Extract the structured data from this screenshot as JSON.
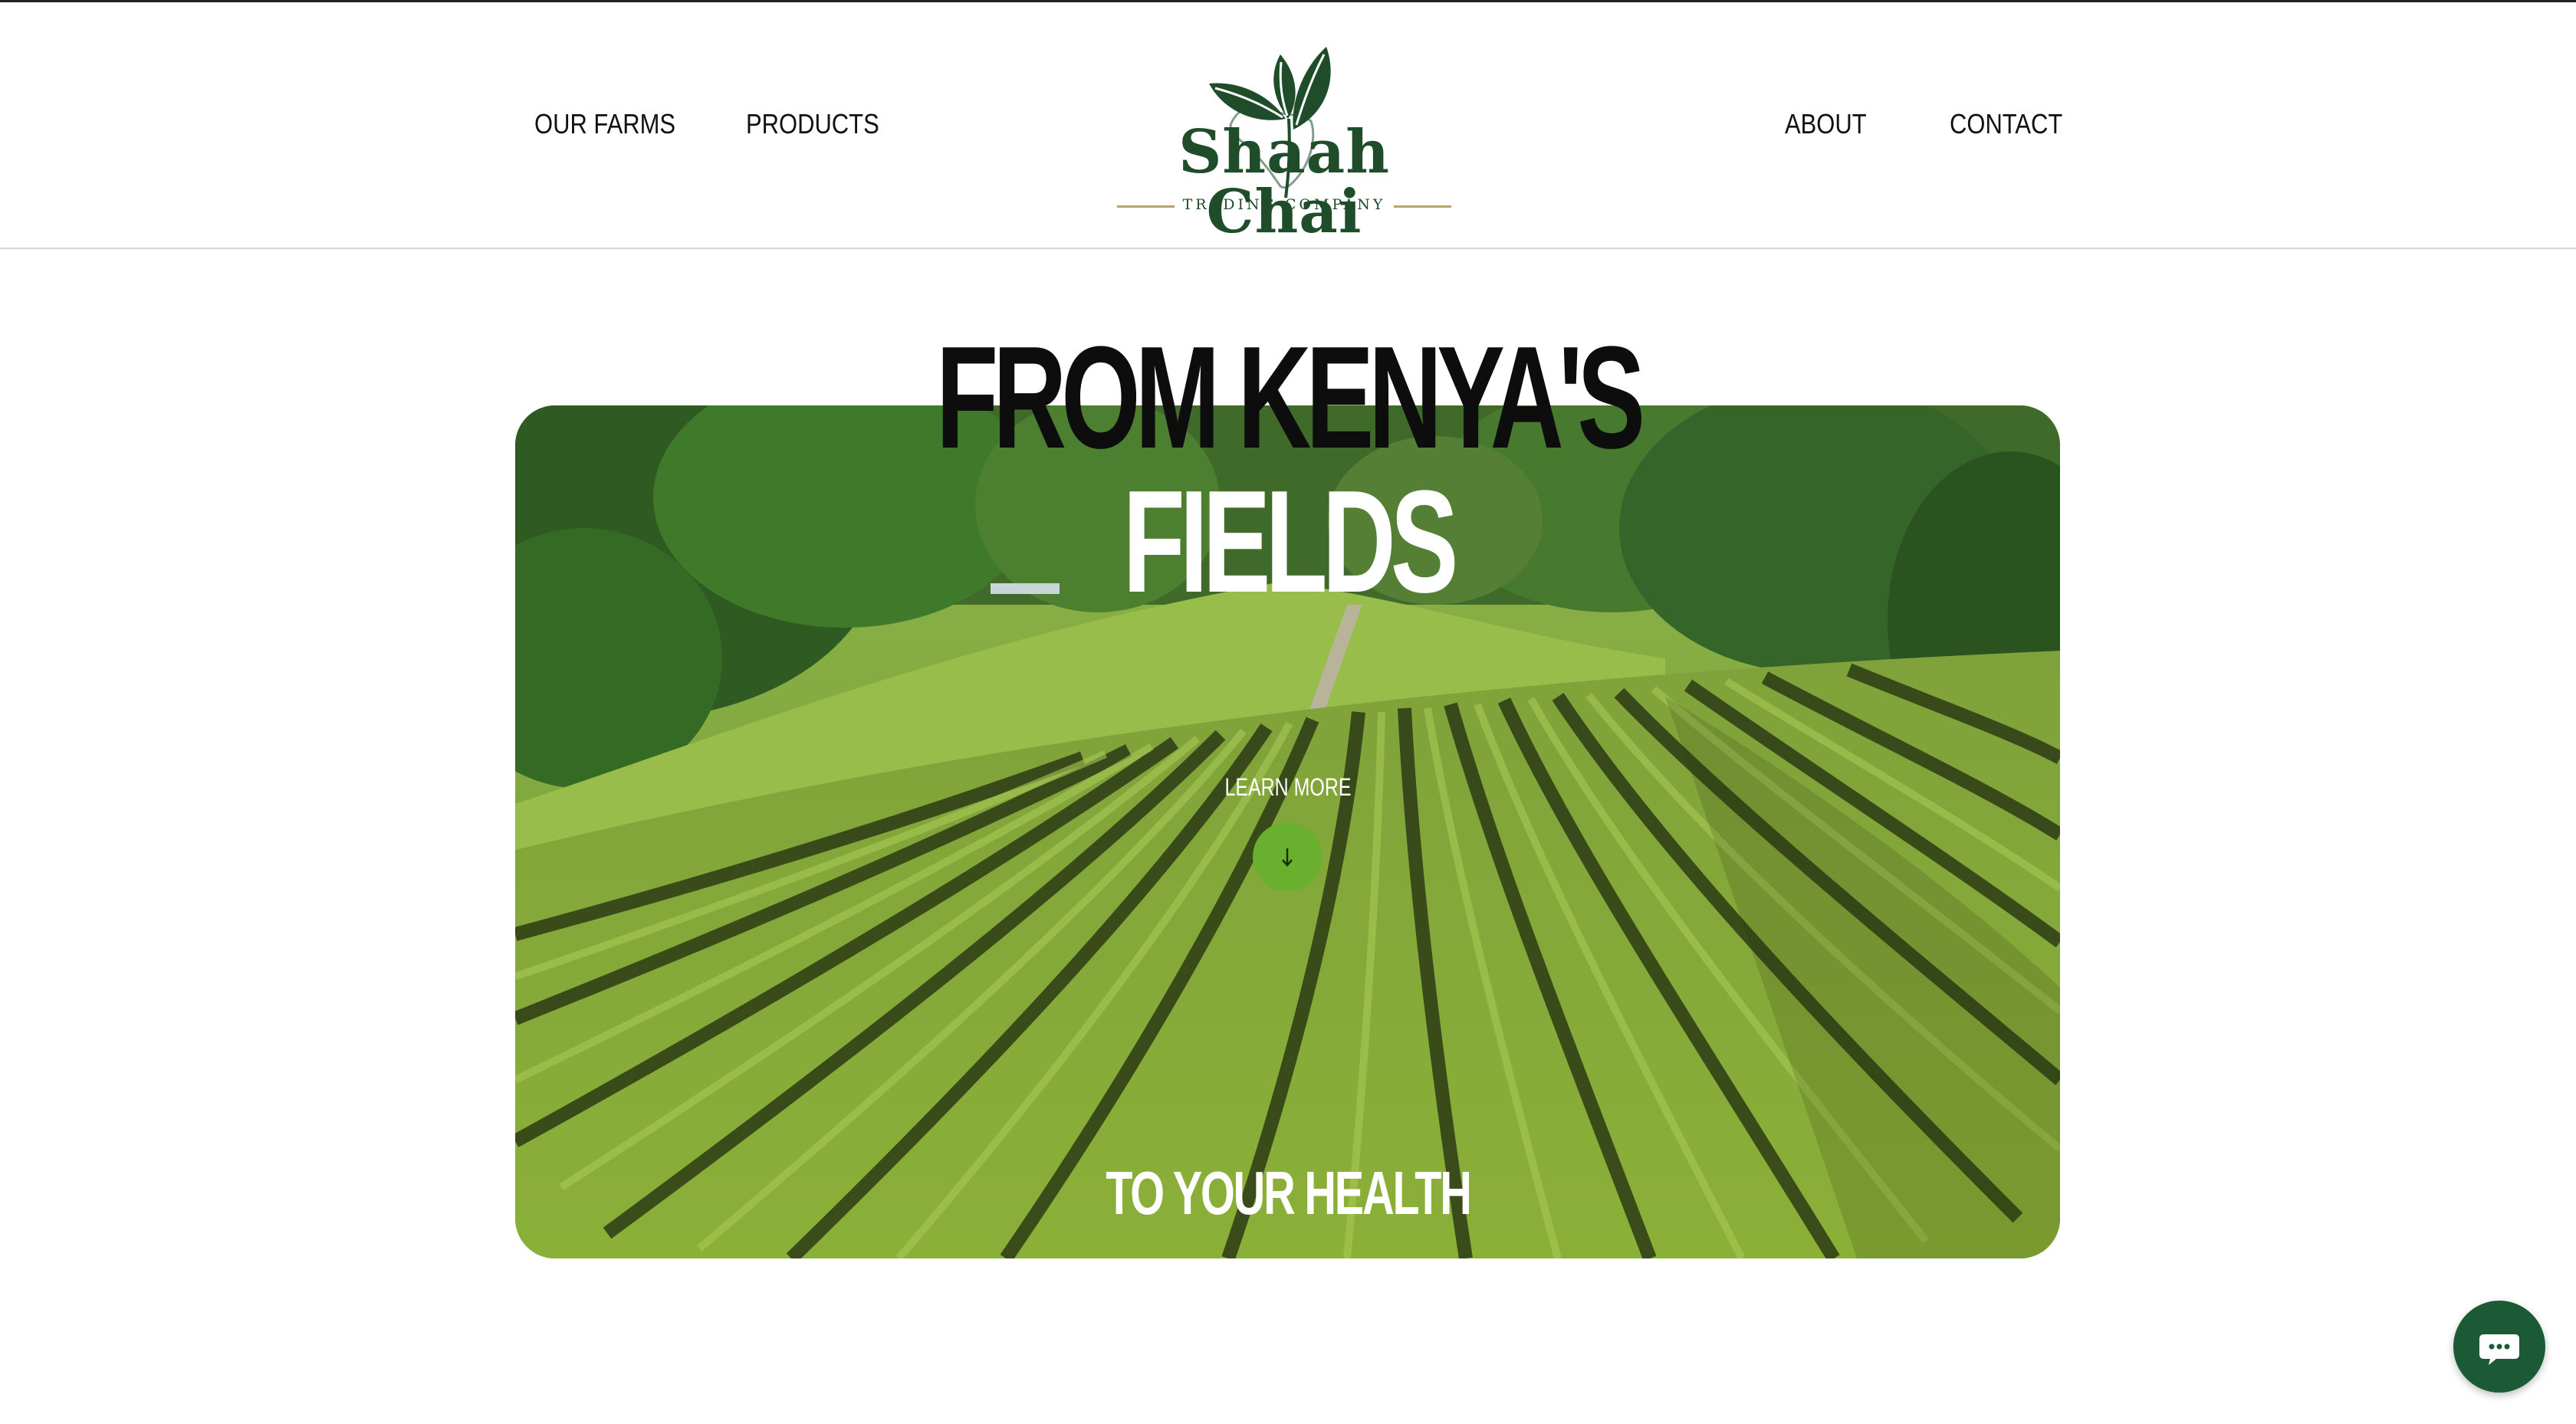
{
  "nav": {
    "left": [
      {
        "label": "OUR FARMS"
      },
      {
        "label": "PRODUCTS"
      }
    ],
    "right": [
      {
        "label": "ABOUT"
      },
      {
        "label": "CONTACT"
      }
    ]
  },
  "logo": {
    "name": "Shaah Chai",
    "subtitle": "TRADING COMPANY",
    "brand_color": "#1f4d2a",
    "accent_color": "#b9a46a"
  },
  "hero": {
    "headline_line1": "FROM KENYA'S",
    "headline_line2": "FIELDS",
    "learn_more": "LEARN MORE",
    "tagline": "TO YOUR HEALTH",
    "button_color": "#69b02e",
    "background_image": "tea-plantation-rows"
  },
  "chat": {
    "icon": "chat-bubble-icon",
    "color": "#1b5a35"
  }
}
